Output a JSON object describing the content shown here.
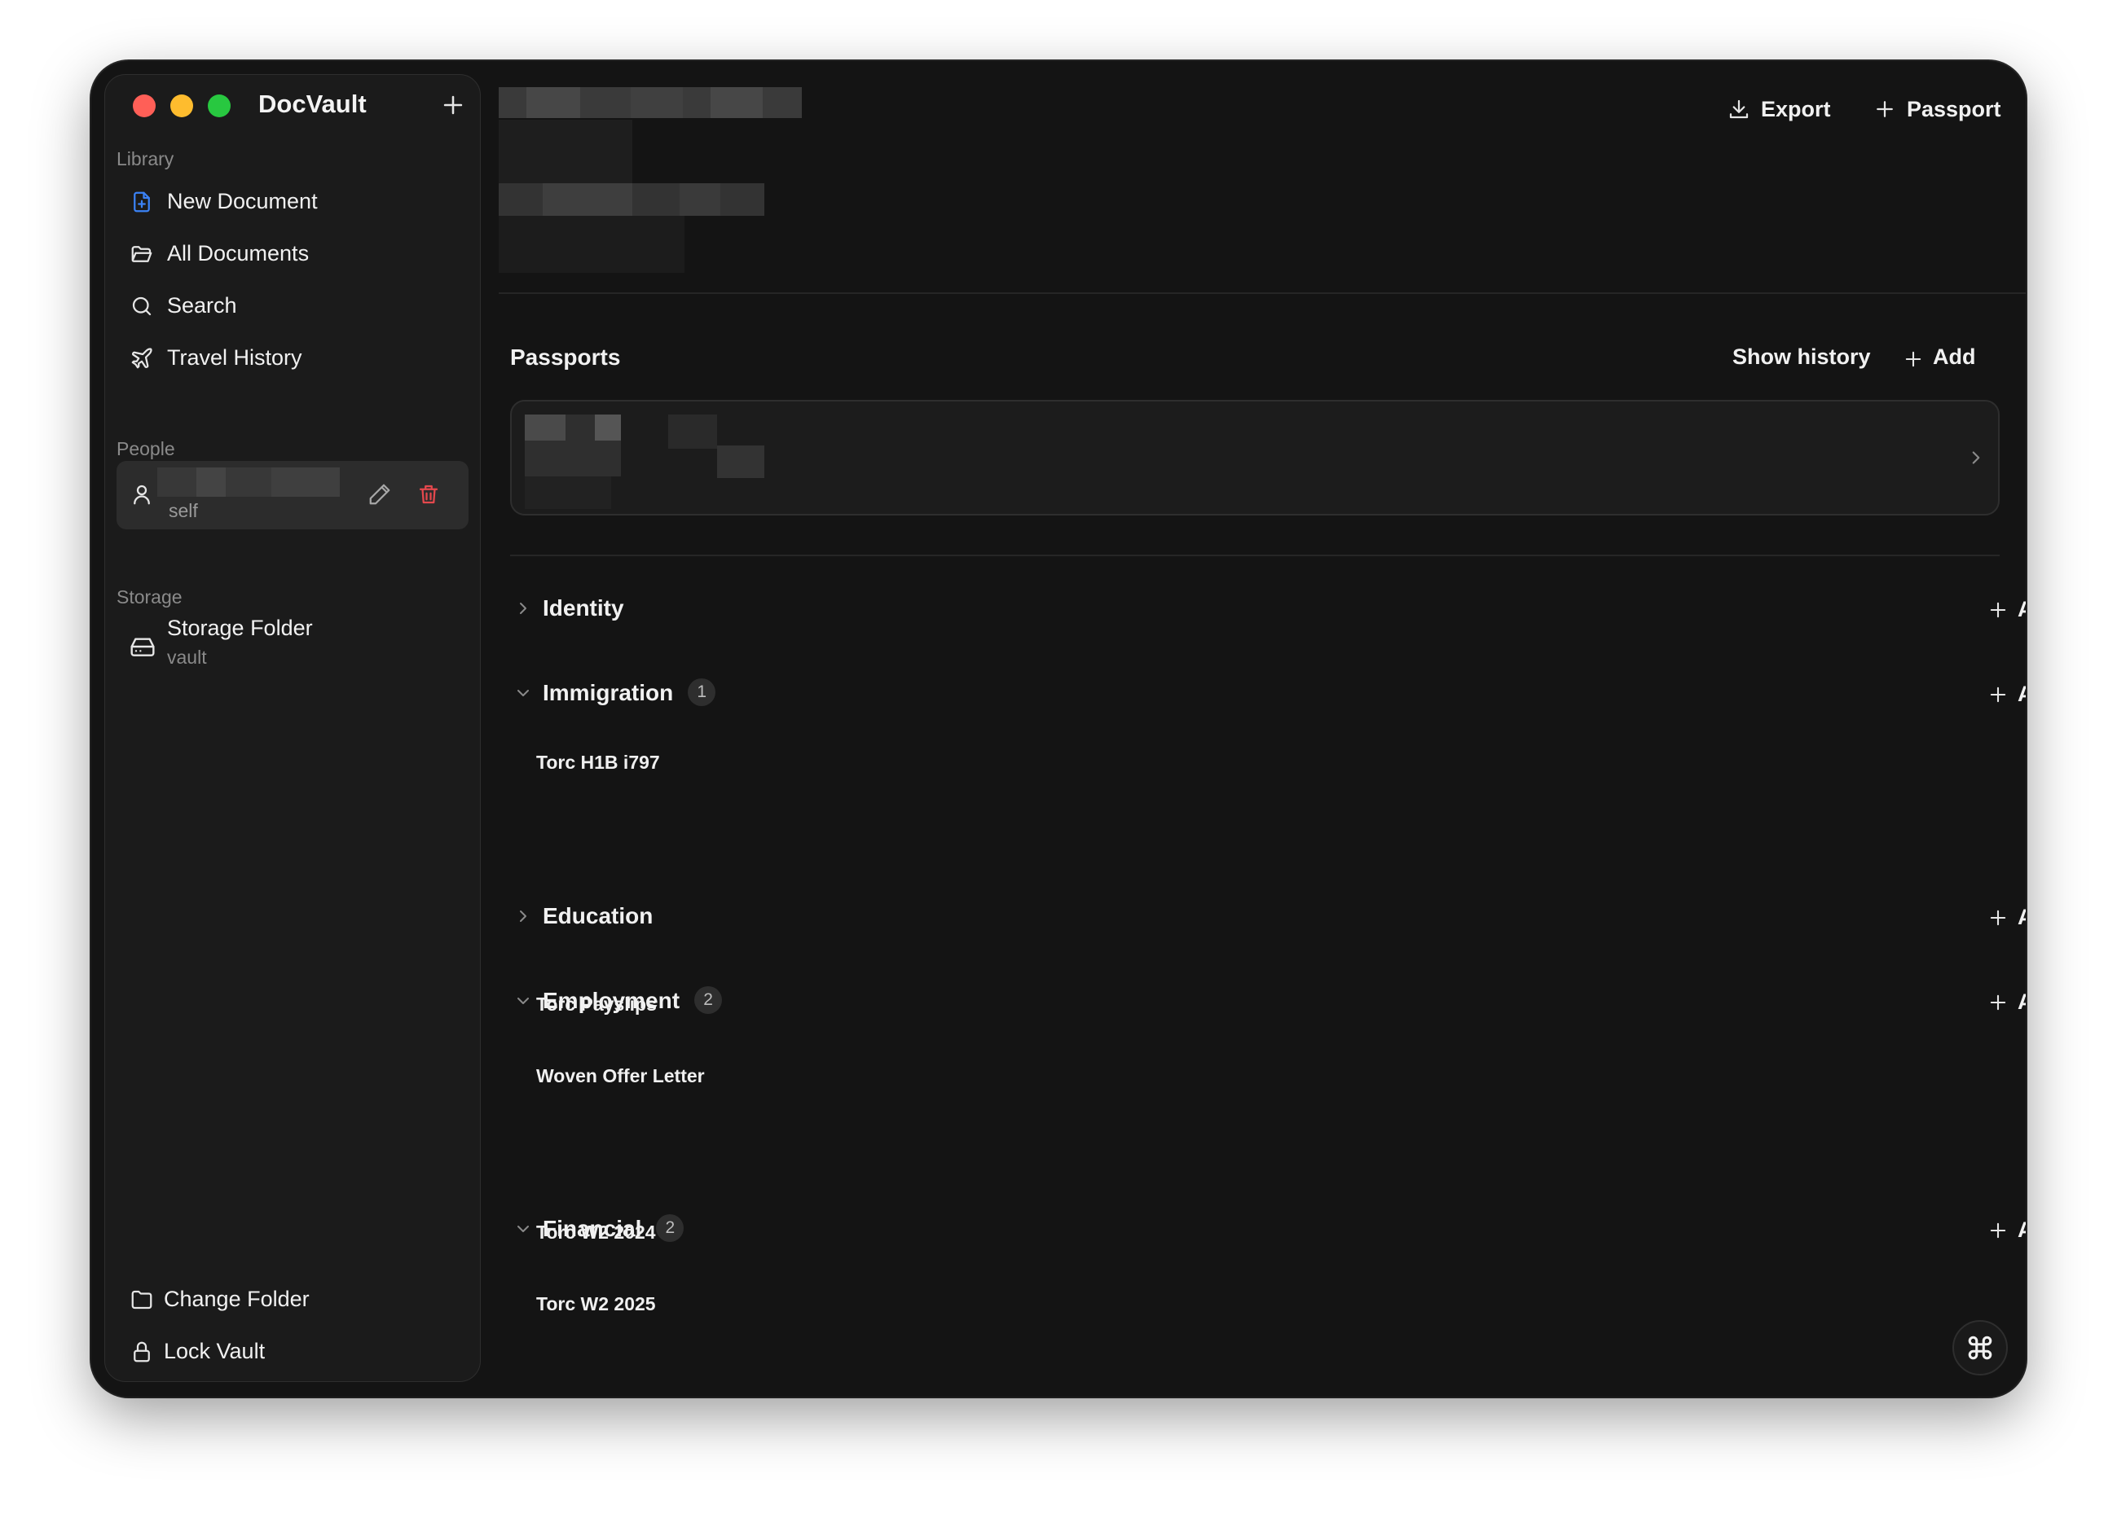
{
  "app": {
    "title": "DocVault"
  },
  "colors": {
    "close": "#ff5f57",
    "minimize": "#febc2e",
    "maximize": "#28c840",
    "accent": "#3b82f6",
    "danger": "#e5484d",
    "background": "#141414",
    "sidebar": "#1b1b1b"
  },
  "sidebar": {
    "library_label": "Library",
    "library_items": [
      {
        "label": "New Document",
        "icon": "file-plus-icon"
      },
      {
        "label": "All Documents",
        "icon": "folder-open-icon"
      },
      {
        "label": "Search",
        "icon": "search-icon"
      },
      {
        "label": "Travel History",
        "icon": "plane-icon"
      }
    ],
    "people_label": "People",
    "person": {
      "relation": "self"
    },
    "storage_label": "Storage",
    "storage": {
      "title": "Storage Folder",
      "subtitle": "vault"
    },
    "footer": {
      "change_folder": "Change Folder",
      "lock_vault": "Lock Vault"
    }
  },
  "toolbar": {
    "export_label": "Export",
    "passport_label": "Passport"
  },
  "passports": {
    "title": "Passports",
    "show_history": "Show history",
    "add_label": "Add"
  },
  "categories": [
    {
      "name": "Identity",
      "expanded": false,
      "count": null,
      "add_label": "Add",
      "items": []
    },
    {
      "name": "Immigration",
      "expanded": true,
      "count": "1",
      "add_label": "Add",
      "items": [
        "Torc H1B i797"
      ]
    },
    {
      "name": "Education",
      "expanded": false,
      "count": null,
      "add_label": "Add",
      "items": []
    },
    {
      "name": "Employment",
      "expanded": true,
      "count": "2",
      "add_label": "Add",
      "items": [
        "Torc Payslips",
        "Woven Offer Letter"
      ]
    },
    {
      "name": "Financial",
      "expanded": true,
      "count": "2",
      "add_label": "Add",
      "items": [
        "Torc W2 2024",
        "Torc W2 2025"
      ]
    }
  ]
}
